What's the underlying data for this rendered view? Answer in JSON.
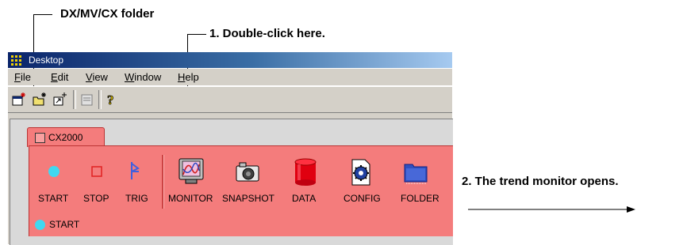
{
  "callouts": {
    "folder": "DX/MV/CX folder",
    "double_click": "1. Double-click here.",
    "opens": "2. The trend monitor opens."
  },
  "window": {
    "title": "Desktop"
  },
  "menu": [
    "File",
    "Edit",
    "View",
    "Window",
    "Help"
  ],
  "folder_tab": {
    "label": "CX2000"
  },
  "icons": [
    {
      "name": "start",
      "label": "START",
      "icon": "cyan-circle"
    },
    {
      "name": "stop",
      "label": "STOP",
      "icon": "red-square"
    },
    {
      "name": "trig",
      "label": "TRIG",
      "icon": "trigger-flag"
    },
    {
      "name": "monitor",
      "label": "MONITOR",
      "icon": "monitor"
    },
    {
      "name": "snapshot",
      "label": "SNAPSHOT",
      "icon": "camera"
    },
    {
      "name": "data",
      "label": "DATA",
      "icon": "red-cylinder"
    },
    {
      "name": "config",
      "label": "CONFIG",
      "icon": "gear-chip"
    },
    {
      "name": "folder",
      "label": "FOLDER",
      "icon": "folder"
    }
  ],
  "status": {
    "text": "START"
  },
  "colors": {
    "panel": "#f47c7c",
    "titlebar": "#0a246a",
    "accent_cyan": "#40d8f0"
  }
}
